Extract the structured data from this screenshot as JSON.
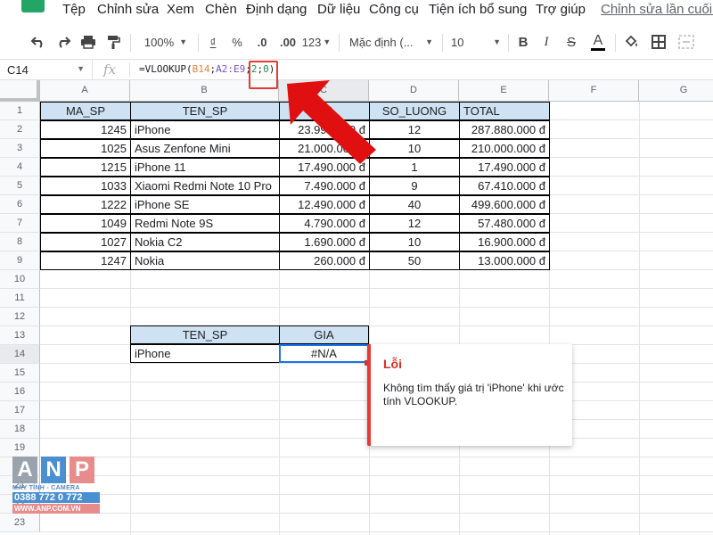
{
  "menu": {
    "items": [
      "Tệp",
      "Chỉnh sửa",
      "Xem",
      "Chèn",
      "Định dạng",
      "Dữ liệu",
      "Công cụ",
      "Tiện ích bổ sung",
      "Trợ giúp"
    ],
    "last_edit": "Chỉnh sửa lần cuối v"
  },
  "toolbar": {
    "zoom": "100%",
    "currency": "₫",
    "percent": "%",
    "decrease_decimal": ".0",
    "increase_decimal": ".00",
    "more_formats": "123",
    "font": "Mặc định (...",
    "font_size": "10",
    "bold": "B",
    "italic": "I",
    "strike": "S",
    "text_color": "A"
  },
  "formula_bar": {
    "name_box": "C14",
    "fx": "fx",
    "parts": {
      "p1": "=VLOOKUP(",
      "ref1": "B14",
      "p2": ";",
      "ref2": "A2:E9",
      "p3": ";",
      "n1": "2",
      "p4": ";",
      "n2": "0",
      "p5": ")"
    }
  },
  "columns": [
    "A",
    "B",
    "C",
    "D",
    "E",
    "F",
    "G"
  ],
  "rows": [
    "1",
    "2",
    "3",
    "4",
    "5",
    "6",
    "7",
    "8",
    "9",
    "10",
    "11",
    "12",
    "13",
    "14",
    "15",
    "16",
    "17",
    "18",
    "19",
    "20",
    "21",
    "22",
    "23"
  ],
  "table": {
    "headers": [
      "MA_SP",
      "TEN_SP",
      "GIA",
      "SO_LUONG",
      "TOTAL"
    ],
    "rows": [
      [
        "1245",
        "iPhone",
        "23.990.000 đ",
        "12",
        "287.880.000 đ"
      ],
      [
        "1025",
        "Asus Zenfone Mini",
        "21.000.000 đ",
        "10",
        "210.000.000 đ"
      ],
      [
        "1215",
        "iPhone 11",
        "17.490.000 đ",
        "1",
        "17.490.000 đ"
      ],
      [
        "1033",
        "Xiaomi Redmi Note 10 Pro",
        "7.490.000 đ",
        "9",
        "67.410.000 đ"
      ],
      [
        "1222",
        "iPhone SE",
        "12.490.000 đ",
        "40",
        "499.600.000 đ"
      ],
      [
        "1049",
        "Redmi Note 9S",
        "4.790.000 đ",
        "12",
        "57.480.000 đ"
      ],
      [
        "1027",
        "Nokia C2",
        "1.690.000 đ",
        "10",
        "16.900.000 đ"
      ],
      [
        "1247",
        "Nokia",
        "260.000 đ",
        "50",
        "13.000.000 đ"
      ]
    ]
  },
  "lookup": {
    "headers": [
      "TEN_SP",
      "GIA"
    ],
    "name": "iPhone",
    "result": "#N/A"
  },
  "error": {
    "title": "Lỗi",
    "message": "Không tìm thấy giá trị 'iPhone' khi ước tính VLOOKUP."
  },
  "watermark": {
    "letters": [
      "A",
      "N",
      "P"
    ],
    "tagline": "MÁY TÍNH - CAMERA",
    "phone": "0388 772 0 772",
    "website": "WWW.ANP.COM.VN"
  },
  "colors": {
    "header_fill": "#cfe2f3",
    "selection": "#1a73e8",
    "error": "#e53935",
    "arrow": "#e01010"
  }
}
